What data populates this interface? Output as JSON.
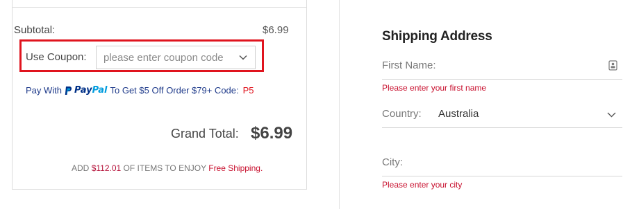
{
  "order_summary": {
    "subtotal_label": "Subtotal:",
    "subtotal_value": "$6.99",
    "coupon": {
      "label": "Use Coupon:",
      "placeholder": "please enter coupon code"
    },
    "paypal_promo": {
      "prefix": "Pay With",
      "logo_pay": "Pay",
      "logo_pal": "Pal",
      "middle": "To Get $5 Off Order $79+ Code:",
      "code": "P5"
    },
    "grand_total_label": "Grand Total:",
    "grand_total_value": "$6.99",
    "free_shipping": {
      "prefix": "ADD",
      "amount": "$112.01",
      "middle": "OF ITEMS TO ENJOY",
      "link": "Free Shipping."
    }
  },
  "shipping_address": {
    "title": "Shipping Address",
    "first_name": {
      "label": "First Name:",
      "error": "Please enter your first name"
    },
    "country": {
      "label": "Country:",
      "value": "Australia"
    },
    "city": {
      "label": "City:",
      "error": "Please enter your city"
    }
  },
  "colors": {
    "highlight": "#e0141e",
    "error": "#c8102e",
    "paypal_dark": "#003087",
    "paypal_light": "#009cde"
  },
  "icons": [
    "chevron-down-icon",
    "paypal-logo-icon",
    "contact-card-icon"
  ]
}
